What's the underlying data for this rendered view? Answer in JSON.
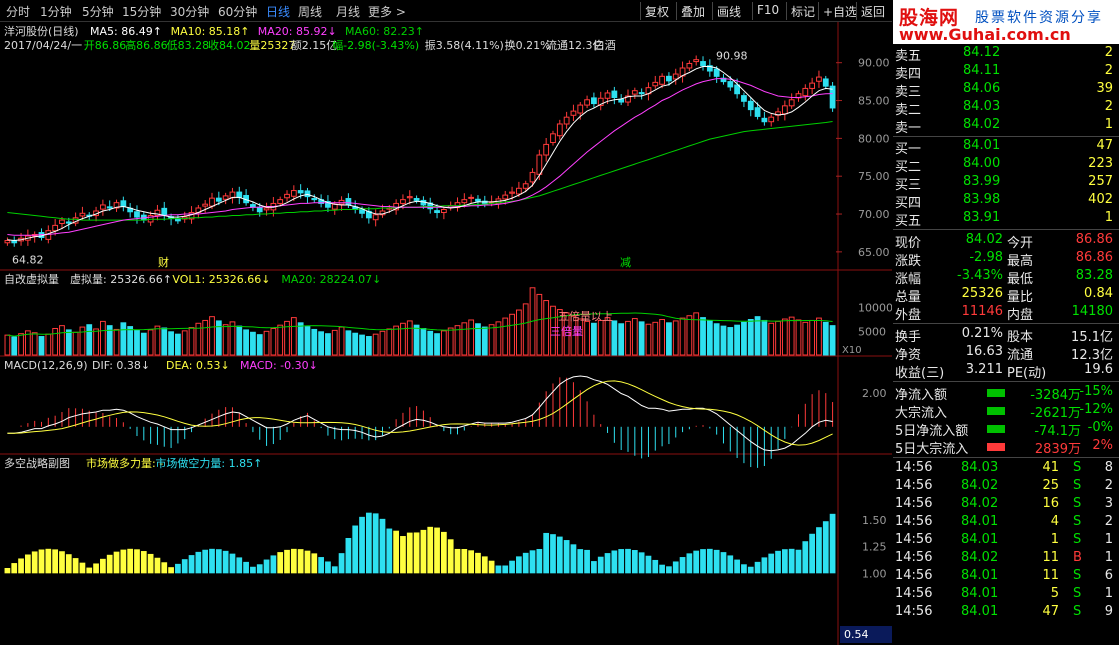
{
  "colors": {
    "up": "#ff3a3a",
    "down": "#2ee0f0",
    "ma5": "#ffffff",
    "ma10": "#ffff40",
    "ma20": "#ff40ff",
    "ma60": "#00d000",
    "accent": "#3a8cff"
  },
  "toolbar": {
    "tabs": [
      "分时",
      "1分钟",
      "5分钟",
      "15分钟",
      "30分钟",
      "60分钟",
      "日线",
      "周线",
      "月线",
      "更多 >"
    ],
    "active_tab": "日线",
    "buttons": [
      "复权",
      "叠加",
      "画线",
      "F10",
      "标记",
      "+自选",
      "返回"
    ]
  },
  "logo": {
    "name": "股海网",
    "slogan": "股票软件资源分享",
    "url": "www.Guhai.com.cn"
  },
  "main_chart": {
    "title": "洋河股份(日线)",
    "ma_legend": [
      {
        "label": "MA5: 86.49↑",
        "color": "#ffffff"
      },
      {
        "label": "MA10: 85.18↑",
        "color": "#ffff40"
      },
      {
        "label": "MA20: 85.92↓",
        "color": "#ff40ff"
      },
      {
        "label": "MA60: 82.23↑",
        "color": "#00d000"
      }
    ],
    "info_line": [
      {
        "text": "2017/04/24/一",
        "color": "#dddddd"
      },
      {
        "text": "开86.86",
        "color": "#00e000"
      },
      {
        "text": "高86.86",
        "color": "#00e000"
      },
      {
        "text": "低83.28",
        "color": "#00e000"
      },
      {
        "text": "收84.02",
        "color": "#00e000"
      },
      {
        "text": "量25327",
        "color": "#ffff40"
      },
      {
        "text": "额2.15亿",
        "color": "#dddddd"
      },
      {
        "text": "幅-2.98(-3.43%)",
        "color": "#00e000"
      },
      {
        "text": "振3.58(4.11%)",
        "color": "#dddddd"
      },
      {
        "text": "换0.21%",
        "color": "#dddddd"
      },
      {
        "text": "流通12.3亿",
        "color": "#dddddd"
      },
      {
        "text": "白酒",
        "color": "#dddddd"
      }
    ],
    "y_ticks": [
      "90.00",
      "85.00",
      "80.00",
      "75.00",
      "70.00",
      "65.00"
    ],
    "high_label": "90.98",
    "low_label": "64.82",
    "markers": [
      "财",
      "减"
    ]
  },
  "volume_panel": {
    "title": "自改虚拟量",
    "items": [
      {
        "text": "虚拟量: 25326.66↑",
        "color": "#dddddd"
      },
      {
        "text": "VOL1: 25326.66↓",
        "color": "#ffff40"
      },
      {
        "text": "MA20: 28224.07↓",
        "color": "#00d000"
      }
    ],
    "annotations": [
      "五倍量以上",
      "三倍量"
    ],
    "y_ticks": [
      "10000",
      "5000"
    ],
    "unit": "X10"
  },
  "macd_panel": {
    "title": "MACD(12,26,9)",
    "items": [
      {
        "text": "DIF: 0.38↓",
        "color": "#dddddd"
      },
      {
        "text": "DEA: 0.53↓",
        "color": "#ffff40"
      },
      {
        "text": "MACD: -0.30↓",
        "color": "#ff40ff"
      }
    ],
    "y_ticks": [
      "2.00"
    ]
  },
  "strategy_panel": {
    "title": "多空战略副图",
    "items": [
      {
        "text": "市场做多力量: -",
        "color": "#ffff40"
      },
      {
        "text": "市场做空力量: 1.85↑",
        "color": "#2ee0f0"
      }
    ],
    "y_ticks": [
      "1.50",
      "1.25",
      "1.00"
    ],
    "cursor_value": "0.54"
  },
  "order_book": {
    "sells": [
      {
        "label": "卖五",
        "price": "84.12",
        "vol": "2"
      },
      {
        "label": "卖四",
        "price": "84.11",
        "vol": "2"
      },
      {
        "label": "卖三",
        "price": "84.06",
        "vol": "39"
      },
      {
        "label": "卖二",
        "price": "84.03",
        "vol": "2"
      },
      {
        "label": "卖一",
        "price": "84.02",
        "vol": "1"
      }
    ],
    "buys": [
      {
        "label": "买一",
        "price": "84.01",
        "vol": "47"
      },
      {
        "label": "买二",
        "price": "84.00",
        "vol": "223"
      },
      {
        "label": "买三",
        "price": "83.99",
        "vol": "257"
      },
      {
        "label": "买四",
        "price": "83.98",
        "vol": "402"
      },
      {
        "label": "买五",
        "price": "83.91",
        "vol": "1"
      }
    ]
  },
  "quote": [
    {
      "l1": "现价",
      "v1": "84.02",
      "c1": "green",
      "l2": "今开",
      "v2": "86.86",
      "c2": "red"
    },
    {
      "l1": "涨跌",
      "v1": "-2.98",
      "c1": "green",
      "l2": "最高",
      "v2": "86.86",
      "c2": "red"
    },
    {
      "l1": "涨幅",
      "v1": "-3.43%",
      "c1": "green",
      "l2": "最低",
      "v2": "83.28",
      "c2": "green"
    },
    {
      "l1": "总量",
      "v1": "25326",
      "c1": "yellow",
      "l2": "量比",
      "v2": "0.84",
      "c2": "yellow"
    },
    {
      "l1": "外盘",
      "v1": "11146",
      "c1": "red",
      "l2": "内盘",
      "v2": "14180",
      "c2": "green"
    }
  ],
  "stats": [
    {
      "l1": "换手",
      "v1": "0.21%",
      "l2": "股本",
      "v2": "15.1亿"
    },
    {
      "l1": "净资",
      "v1": "16.63",
      "l2": "流通",
      "v2": "12.3亿"
    },
    {
      "l1": "收益(三)",
      "v1": "3.211",
      "l2": "PE(动)",
      "v2": "19.6"
    }
  ],
  "flows": [
    {
      "label": "净流入额",
      "value": "-3284万",
      "pct": "-15%",
      "color": "green"
    },
    {
      "label": "大宗流入",
      "value": "-2621万",
      "pct": "-12%",
      "color": "green"
    },
    {
      "label": "5日净流入额",
      "value": "-74.1万",
      "pct": "-0%",
      "color": "green"
    },
    {
      "label": "5日大宗流入",
      "value": "2839万",
      "pct": "2%",
      "color": "red"
    }
  ],
  "ticks": [
    {
      "time": "14:56",
      "price": "84.03",
      "vol": "41",
      "side": "S",
      "n": "8"
    },
    {
      "time": "14:56",
      "price": "84.02",
      "vol": "25",
      "side": "S",
      "n": "2"
    },
    {
      "time": "14:56",
      "price": "84.02",
      "vol": "16",
      "side": "S",
      "n": "3"
    },
    {
      "time": "14:56",
      "price": "84.01",
      "vol": "4",
      "side": "S",
      "n": "2"
    },
    {
      "time": "14:56",
      "price": "84.01",
      "vol": "1",
      "side": "S",
      "n": "1"
    },
    {
      "time": "14:56",
      "price": "84.02",
      "vol": "11",
      "side": "B",
      "n": "1"
    },
    {
      "time": "14:56",
      "price": "84.01",
      "vol": "11",
      "side": "S",
      "n": "6"
    },
    {
      "time": "14:56",
      "price": "84.01",
      "vol": "5",
      "side": "S",
      "n": "1"
    },
    {
      "time": "14:56",
      "price": "84.01",
      "vol": "47",
      "side": "S",
      "n": "9"
    }
  ],
  "chart_data": {
    "type": "candlestick",
    "title": "洋河股份(日线)",
    "ylim": [
      63,
      93
    ],
    "close": [
      66.5,
      66.2,
      66.8,
      67.1,
      67.3,
      66.9,
      67.8,
      68.5,
      69.2,
      68.8,
      69.5,
      70.1,
      69.8,
      70.4,
      71.2,
      70.8,
      71.5,
      71.0,
      70.3,
      69.6,
      69.2,
      69.8,
      70.5,
      69.9,
      69.4,
      69.1,
      69.6,
      70.2,
      70.8,
      71.3,
      72.1,
      71.7,
      72.4,
      72.9,
      72.2,
      71.5,
      70.9,
      70.3,
      70.8,
      71.4,
      71.9,
      72.6,
      73.1,
      72.8,
      72.3,
      71.9,
      71.4,
      70.9,
      71.3,
      71.8,
      71.2,
      70.6,
      70.1,
      69.5,
      69.9,
      70.4,
      70.8,
      71.4,
      71.9,
      72.3,
      71.8,
      71.2,
      70.7,
      70.2,
      70.6,
      71.1,
      71.5,
      71.9,
      72.2,
      71.7,
      71.3,
      71.6,
      72.0,
      72.5,
      72.9,
      73.4,
      74.0,
      75.5,
      77.8,
      79.2,
      80.6,
      81.9,
      82.8,
      83.6,
      84.4,
      85.1,
      84.6,
      85.3,
      86.0,
      85.4,
      84.8,
      85.6,
      86.3,
      85.9,
      86.7,
      87.4,
      88.2,
      87.6,
      88.5,
      89.3,
      89.9,
      90.4,
      89.6,
      88.9,
      88.2,
      87.5,
      86.8,
      85.9,
      84.9,
      83.8,
      82.9,
      82.2,
      82.8,
      83.5,
      84.3,
      85.1,
      85.9,
      86.6,
      87.3,
      88.1,
      86.9,
      84.02
    ],
    "volume_x10": [
      4200,
      3800,
      4500,
      5100,
      4700,
      3900,
      4400,
      5600,
      6200,
      5300,
      4800,
      5900,
      6400,
      5500,
      7100,
      6200,
      5400,
      6800,
      6000,
      5200,
      4600,
      5300,
      6100,
      5700,
      4900,
      4400,
      5100,
      5800,
      6700,
      7300,
      8100,
      7200,
      6400,
      7000,
      6100,
      5300,
      4800,
      4300,
      5000,
      5600,
      6300,
      7100,
      7900,
      6800,
      6000,
      5400,
      4900,
      4500,
      5200,
      5900,
      5100,
      4600,
      4200,
      3900,
      4400,
      5000,
      5500,
      6100,
      6700,
      7200,
      6300,
      5600,
      5000,
      4500,
      5100,
      5700,
      6200,
      6800,
      7400,
      6600,
      5900,
      6400,
      7000,
      7800,
      8600,
      9500,
      10800,
      14200,
      12800,
      11500,
      10300,
      9600,
      8900,
      8200,
      7600,
      7100,
      6700,
      7300,
      7900,
      7200,
      6600,
      7100,
      7700,
      7000,
      6500,
      6900,
      7500,
      6800,
      7200,
      7800,
      8300,
      8900,
      7900,
      7200,
      6600,
      6100,
      5800,
      6300,
      6900,
      7500,
      8100,
      7300,
      6700,
      7100,
      7600,
      8000,
      7400,
      6900,
      7300,
      7800,
      6900,
      6200
    ],
    "ma5": [
      66.6,
      66.5,
      66.6,
      66.8,
      67.0,
      67.1,
      67.4,
      67.7,
      68.1,
      68.6,
      69.0,
      69.4,
      69.7,
      70.0,
      70.4,
      70.6,
      70.9,
      71.0,
      70.8,
      70.5,
      70.3,
      70.1,
      70.0,
      69.8,
      69.6,
      69.6,
      69.7,
      69.9,
      70.2,
      70.6,
      71.0,
      71.4,
      71.8,
      72.2,
      72.2,
      71.9,
      71.6,
      71.2,
      70.9,
      70.9,
      71.1,
      71.5,
      72.0,
      72.4,
      72.6,
      72.3,
      71.9,
      71.5,
      71.3,
      71.2,
      71.2,
      71.0,
      70.7,
      70.3,
      70.0,
      70.0,
      70.3,
      70.7,
      71.1,
      71.5,
      71.7,
      71.6,
      71.4,
      71.1,
      70.9,
      70.8,
      70.9,
      71.1,
      71.4,
      71.6,
      71.6,
      71.6,
      71.7,
      71.8,
      72.1,
      72.5,
      73.0,
      73.8,
      75.1,
      76.6,
      78.1,
      79.6,
      80.9,
      82.0,
      82.9,
      83.6,
      84.0,
      84.5,
      84.9,
      85.1,
      85.2,
      85.5,
      85.6,
      85.6,
      85.9,
      86.4,
      86.9,
      87.1,
      87.7,
      88.3,
      88.7,
      89.2,
      89.5,
      89.5,
      89.3,
      88.7,
      88.0,
      87.2,
      86.3,
      85.4,
      84.5,
      83.7,
      83.3,
      83.1,
      83.2,
      83.5,
      84.1,
      84.8,
      85.6,
      86.3,
      86.6,
      86.49
    ],
    "ma20": [
      67.3,
      67.2,
      67.2,
      67.2,
      67.2,
      67.3,
      67.3,
      67.4,
      67.5,
      67.6,
      67.8,
      68.0,
      68.2,
      68.4,
      68.6,
      68.8,
      69.0,
      69.2,
      69.3,
      69.4,
      69.5,
      69.6,
      69.7,
      69.8,
      69.9,
      69.9,
      70.0,
      70.0,
      70.0,
      70.1,
      70.2,
      70.3,
      70.4,
      70.6,
      70.7,
      70.8,
      70.9,
      70.9,
      71.0,
      71.0,
      71.1,
      71.2,
      71.3,
      71.4,
      71.4,
      71.5,
      71.5,
      71.5,
      71.5,
      71.5,
      71.5,
      71.4,
      71.3,
      71.2,
      71.1,
      71.0,
      71.0,
      70.9,
      70.9,
      70.9,
      70.9,
      70.9,
      70.9,
      70.9,
      70.9,
      70.9,
      71.0,
      71.0,
      71.1,
      71.1,
      71.2,
      71.2,
      71.3,
      71.4,
      71.6,
      71.8,
      72.1,
      72.5,
      73.0,
      73.6,
      74.3,
      75.0,
      75.8,
      76.6,
      77.4,
      78.2,
      78.9,
      79.6,
      80.3,
      81.0,
      81.6,
      82.2,
      82.8,
      83.3,
      83.9,
      84.4,
      85.0,
      85.4,
      85.9,
      86.4,
      86.8,
      87.2,
      87.5,
      87.7,
      87.9,
      87.9,
      87.8,
      87.6,
      87.3,
      87.0,
      86.6,
      86.2,
      85.9,
      85.6,
      85.5,
      85.4,
      85.4,
      85.5,
      85.6,
      85.8,
      85.9,
      85.92
    ],
    "ma60": [
      70.2,
      70.1,
      70.0,
      69.9,
      69.8,
      69.7,
      69.6,
      69.5,
      69.4,
      69.3,
      69.3,
      69.2,
      69.2,
      69.2,
      69.2,
      69.2,
      69.2,
      69.2,
      69.2,
      69.2,
      69.2,
      69.3,
      69.3,
      69.3,
      69.4,
      69.4,
      69.4,
      69.5,
      69.5,
      69.6,
      69.6,
      69.7,
      69.7,
      69.8,
      69.8,
      69.9,
      69.9,
      70.0,
      70.0,
      70.1,
      70.1,
      70.2,
      70.2,
      70.3,
      70.3,
      70.4,
      70.4,
      70.5,
      70.5,
      70.6,
      70.6,
      70.6,
      70.7,
      70.7,
      70.7,
      70.8,
      70.8,
      70.8,
      70.9,
      70.9,
      70.9,
      71.0,
      71.0,
      71.0,
      71.1,
      71.1,
      71.1,
      71.2,
      71.2,
      71.3,
      71.3,
      71.4,
      71.5,
      71.6,
      71.7,
      71.8,
      72.0,
      72.2,
      72.4,
      72.7,
      73.0,
      73.3,
      73.6,
      73.9,
      74.2,
      74.5,
      74.8,
      75.1,
      75.4,
      75.7,
      76.0,
      76.3,
      76.6,
      76.9,
      77.2,
      77.5,
      77.8,
      78.1,
      78.4,
      78.7,
      79.0,
      79.3,
      79.6,
      79.9,
      80.1,
      80.3,
      80.5,
      80.7,
      80.9,
      81.0,
      81.1,
      81.2,
      81.3,
      81.4,
      81.5,
      81.6,
      81.7,
      81.8,
      81.9,
      82.0,
      82.1,
      82.23
    ],
    "macd_ylim": [
      -1.5,
      3.5
    ],
    "strength_ylim": [
      0.9,
      1.95
    ]
  }
}
